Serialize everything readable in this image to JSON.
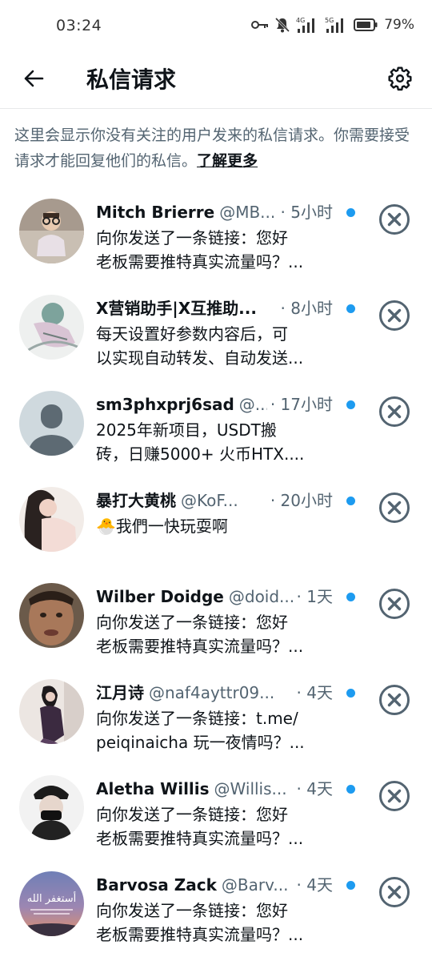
{
  "status_bar": {
    "time": "03:24",
    "battery": "79%",
    "icons": [
      "key-icon",
      "mute-bell-icon",
      "signal-4g-icon",
      "signal-5g-icon",
      "battery-icon"
    ],
    "network_1": "4G",
    "network_2": "5G"
  },
  "header": {
    "title": "私信请求",
    "back_icon": "arrow-left-icon",
    "settings_icon": "gear-icon"
  },
  "info": {
    "text": "这里会显示你没有关注的用户发来的私信请求。你需要接受请求才能回复他们的私信。",
    "link": "了解更多"
  },
  "requests": [
    {
      "name": "Mitch Brierre",
      "handle": "@MB...",
      "time": "· 5小时",
      "line1": "向你发送了一条链接：您好",
      "line2": "老板需要推特真实流量吗？..."
    },
    {
      "name": "X营销助手|X互推助...",
      "handle": "",
      "time": "· 8小时",
      "line1": "每天设置好参数内容后，可",
      "line2": "以实现自动转发、自动发送..."
    },
    {
      "name": "sm3phxprj6sad",
      "handle": "@...",
      "time": "· 17小时",
      "line1": "2025年新项目，USDT搬",
      "line2": "砖，日赚5000+ 火币HTX...."
    },
    {
      "name": "暴打大黄桃",
      "handle": "@KoF...",
      "time": "· 20小时",
      "line1": "🐣我們一快玩耍啊",
      "line2": ""
    },
    {
      "name": "Wilber Doidge",
      "handle": "@doid...",
      "time": "· 1天",
      "line1": "向你发送了一条链接：您好",
      "line2": "老板需要推特真实流量吗？..."
    },
    {
      "name": "江月诗",
      "handle": "@naf4ayttr09...",
      "time": "· 4天",
      "line1": "向你发送了一条链接：t.me/",
      "line2": "peiqinaicha 玩一夜情吗？..."
    },
    {
      "name": "Aletha Willis",
      "handle": "@Willis...",
      "time": "· 4天",
      "line1": "向你发送了一条链接：您好",
      "line2": "老板需要推特真实流量吗？..."
    },
    {
      "name": "Barvosa Zack",
      "handle": "@Barv...",
      "time": "· 4天",
      "line1": "向你发送了一条链接：您好",
      "line2": "老板需要推特真实流量吗？..."
    }
  ],
  "avatar_text": "أستغفر الله",
  "colors": {
    "unread_dot": "#1d9bf0",
    "secondary_text": "#536471",
    "primary_text": "#0f1419",
    "close_icon": "#536471"
  }
}
